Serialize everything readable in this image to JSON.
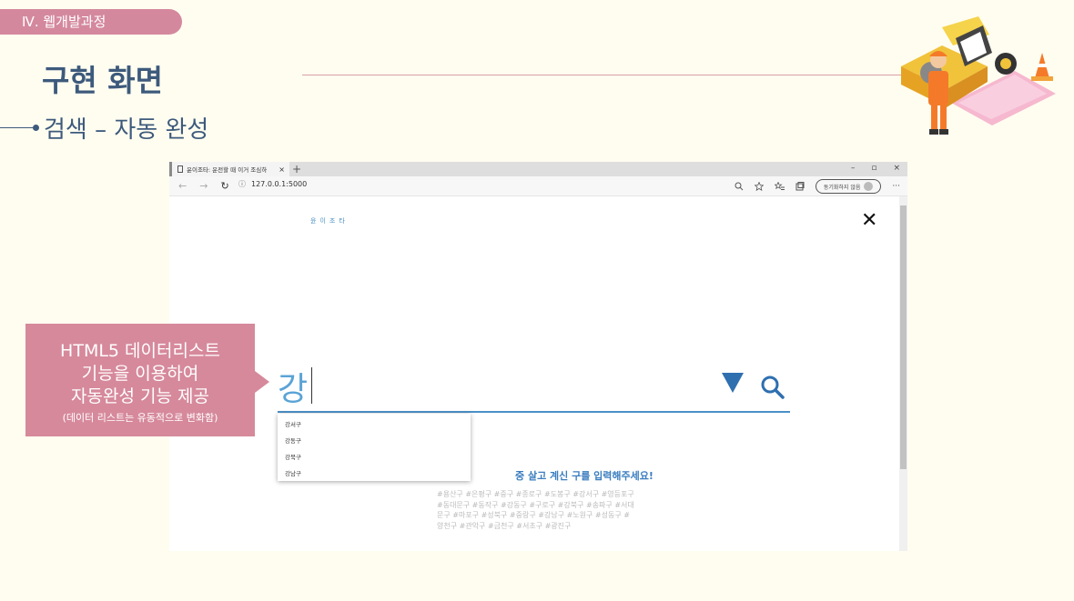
{
  "slide": {
    "section": "Ⅳ.  웹개발과정",
    "title": "구현 화면",
    "subtitle": "검색 – 자동 완성"
  },
  "browser": {
    "tab_title": "윤이조타: 운전할 때 이거 조심하",
    "tab_close": "×",
    "new_tab": "+",
    "window_controls": [
      "–",
      "▫",
      "×"
    ],
    "nav": {
      "back": "←",
      "forward": "→",
      "refresh": "↻"
    },
    "url_info_icon": "ⓘ",
    "url": "127.0.0.1:5000",
    "toolbar_icons": [
      "zoom-icon",
      "favorite-star-icon",
      "favorites-icon",
      "collections-icon"
    ],
    "sync_label": "동기화하지 않음",
    "more": "···"
  },
  "page": {
    "logo": "윤이조타",
    "close": "✕",
    "search_value": "강",
    "datalist_options": [
      "강서구",
      "강동구",
      "강북구",
      "강남구"
    ],
    "prompt": "중 살고 계신 구를 입력해주세요!",
    "district_tags": "#용산구 #은평구 #중구 #종로구 #도봉구 #강서구 #영등포구 #동대문구 #동작구 #강동구 #구로구 #강북구 #송파구 #서대문구 #마포구 #성북구 #중랑구 #강남구 #노원구 #성동구 #양천구 #관악구 #금천구 #서초구 #광진구"
  },
  "callout": {
    "lines": [
      "HTML5 데이터리스트",
      "기능을 이용하여",
      "자동완성 기능 제공"
    ],
    "note": "(데이터 리스트는 유동적으로 변화함)"
  },
  "colors": {
    "accent_pink": "#d6899b",
    "title_navy": "#3d5a7c",
    "search_blue": "#4a90c8",
    "arrow_blue": "#2e6fb0"
  }
}
